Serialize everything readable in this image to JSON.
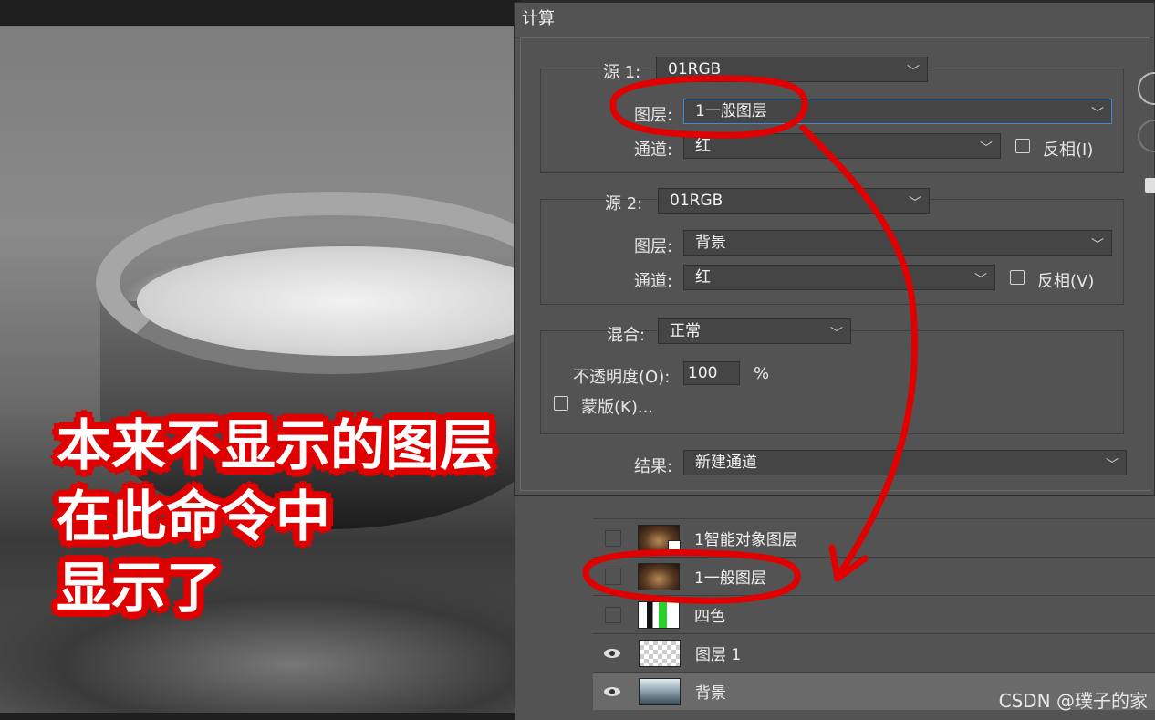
{
  "canvas": {
    "annotation_lines": [
      "本来不显示的图层",
      "在此命令中",
      "显示了"
    ]
  },
  "dialog": {
    "title": "计算",
    "source1": {
      "label": "源 1:",
      "file": "01RGB",
      "layer_label": "图层:",
      "layer": "1一般图层",
      "channel_label": "通道:",
      "channel": "红",
      "invert_label": "反相(I)",
      "invert_checked": false
    },
    "source2": {
      "label": "源 2:",
      "file": "01RGB",
      "layer_label": "图层:",
      "layer": "背景",
      "channel_label": "通道:",
      "channel": "红",
      "invert_label": "反相(V)",
      "invert_checked": false
    },
    "blend": {
      "label": "混合:",
      "mode": "正常",
      "opacity_label": "不透明度(O):",
      "opacity": "100",
      "opacity_unit": "%",
      "mask_label": "蒙版(K)...",
      "mask_checked": false
    },
    "result": {
      "label": "结果:",
      "value": "新建通道"
    }
  },
  "layers": [
    {
      "name": "1智能对象图层",
      "visible": false,
      "thumb": "bowl-smart"
    },
    {
      "name": "1一般图层",
      "visible": false,
      "thumb": "bowl"
    },
    {
      "name": "四色",
      "visible": false,
      "thumb": "fourcolor"
    },
    {
      "name": "图层 1",
      "visible": true,
      "thumb": "checker"
    },
    {
      "name": "背景",
      "visible": true,
      "thumb": "bg"
    }
  ],
  "watermark": "CSDN @璞子的家",
  "colors": {
    "annotation_red": "#e10000",
    "dialog_bg": "#535353",
    "field_bg": "#454545",
    "focus_blue": "#3c8ad8"
  }
}
